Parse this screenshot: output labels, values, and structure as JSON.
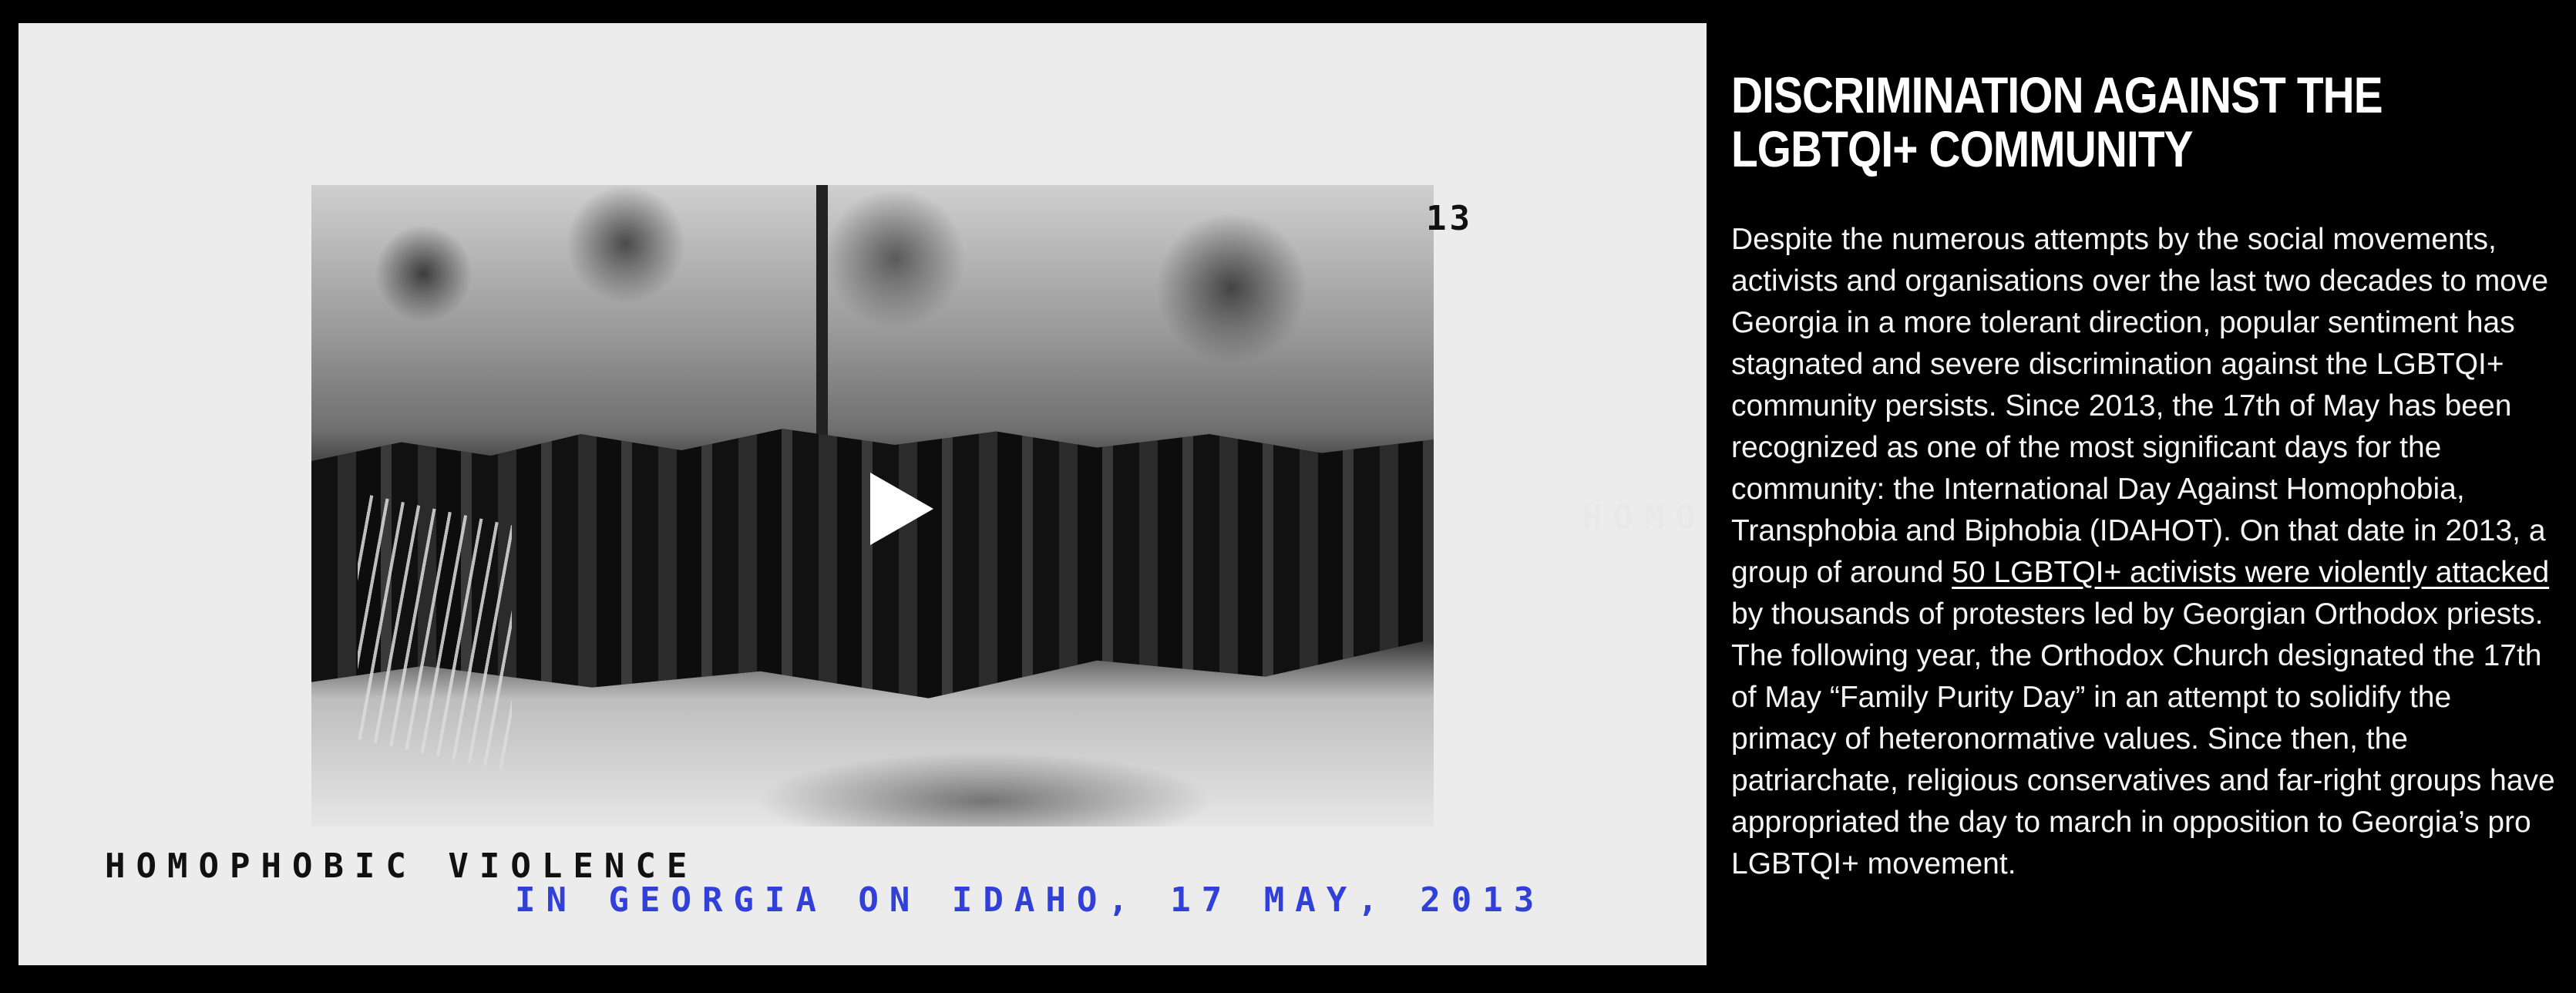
{
  "video": {
    "overlay_year_fragment": "13",
    "caption_line1": "HOMOPHOBIC VIOLENCE",
    "caption_line2": "IN GEORGIA ON IDAHO, 17 MAY, 2013",
    "overlay_fragment": "HOMO",
    "play_icon": "play-icon",
    "caption_color": "#3040d8"
  },
  "article": {
    "title": "DISCRIMINATION AGAINST THE LGBTQI+ COMMUNITY",
    "paragraph_before_link": "Despite the numerous attempts by the social movements, activists and organisations over the last two decades to move Georgia in a more tolerant direction, popular sentiment has stagnated and severe discrimination against the LGBTQI+ community persists. Since 2013, the 17th of May has been recognized as one of the most significant days for the community: the International Day Against Homophobia, Transphobia and Biphobia (IDAHOT). On that date in 2013, a group of around ",
    "link_text": "50 LGBTQI+ activists were violently attacked",
    "paragraph_after_link": " by thousands of protesters led by Georgian Orthodox priests. The following year, the Orthodox Church designated the 17th of May “Family Purity Day” in an attempt to solidify the primacy of heteronormative values. Since then, the patriarchate, religious conservatives and far-right groups have appropriated the day to march in opposition to Georgia’s pro LGBTQI+ movement."
  }
}
